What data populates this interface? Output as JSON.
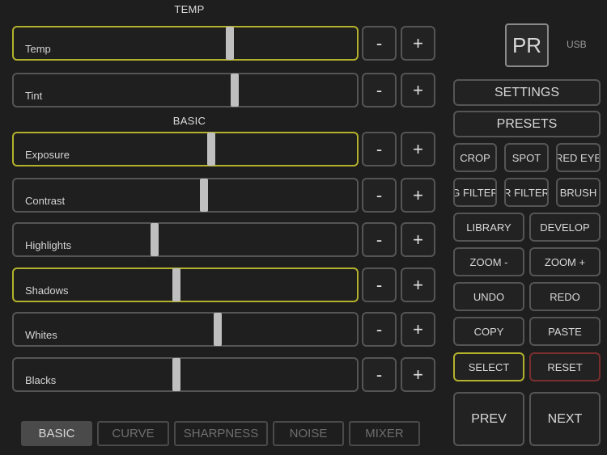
{
  "sections": {
    "temp": "TEMP",
    "basic": "BASIC"
  },
  "sliders": [
    {
      "label": "Temp",
      "value": 0.63,
      "active": true
    },
    {
      "label": "Tint",
      "value": 0.645,
      "active": false
    },
    {
      "label": "Exposure",
      "value": 0.575,
      "active": true
    },
    {
      "label": "Contrast",
      "value": 0.555,
      "active": false
    },
    {
      "label": "Highlights",
      "value": 0.41,
      "active": false
    },
    {
      "label": "Shadows",
      "value": 0.475,
      "active": true
    },
    {
      "label": "Whites",
      "value": 0.595,
      "active": false
    },
    {
      "label": "Blacks",
      "value": 0.475,
      "active": false
    }
  ],
  "steppers": {
    "minus": "-",
    "plus": "+"
  },
  "logo": {
    "text": "PR",
    "status": "USB"
  },
  "right_panel": {
    "settings": "SETTINGS",
    "presets": "PRESETS",
    "crop": "CROP",
    "spot": "SPOT",
    "red_eye": "RED EYE",
    "g_filter": "G FILTER",
    "r_filter": "R FILTER",
    "brush": "BRUSH",
    "library": "LIBRARY",
    "develop": "DEVELOP",
    "zoom_out": "ZOOM  -",
    "zoom_in": "ZOOM +",
    "undo": "UNDO",
    "redo": "REDO",
    "copy": "COPY",
    "paste": "PASTE",
    "select": "SELECT",
    "reset": "RESET",
    "prev": "PREV",
    "next": "NEXT"
  },
  "tabs": [
    {
      "label": "BASIC",
      "active": true
    },
    {
      "label": "CURVE",
      "active": false
    },
    {
      "label": "SHARPNESS",
      "active": false
    },
    {
      "label": "NOISE",
      "active": false
    },
    {
      "label": "MIXER",
      "active": false
    }
  ],
  "colors": {
    "accent": "#b3b12c",
    "reset": "#7a2f2f",
    "background": "#1e1e1e"
  }
}
